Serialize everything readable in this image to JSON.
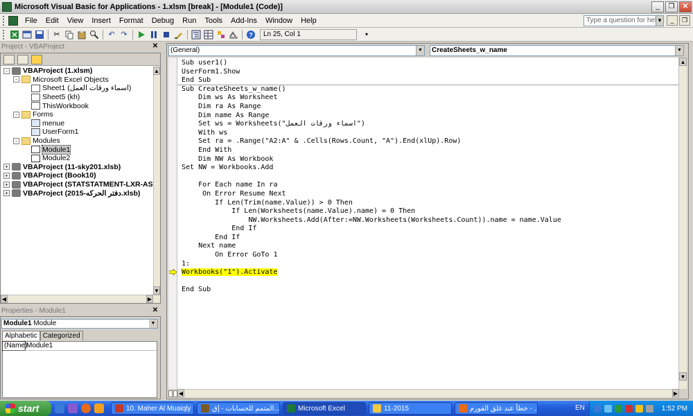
{
  "window": {
    "title": "Microsoft Visual Basic for Applications - 1.xlsm [break] - [Module1 (Code)]"
  },
  "menubar": {
    "items": [
      "File",
      "Edit",
      "View",
      "Insert",
      "Format",
      "Debug",
      "Run",
      "Tools",
      "Add-Ins",
      "Window",
      "Help"
    ],
    "help_placeholder": "Type a question for help"
  },
  "toolbar": {
    "position": "Ln 25, Col 1"
  },
  "project": {
    "title": "Project - VBAProject",
    "tree": [
      {
        "level": 0,
        "expander": "-",
        "icon": "vba",
        "label": "VBAProject (1.xlsm)",
        "bold": true
      },
      {
        "level": 1,
        "expander": "-",
        "icon": "folder",
        "label": "Microsoft Excel Objects"
      },
      {
        "level": 2,
        "expander": "",
        "icon": "sheet",
        "label": "Sheet1 (اسماء ورقات العمل)"
      },
      {
        "level": 2,
        "expander": "",
        "icon": "sheet",
        "label": "Sheet5 (kh)"
      },
      {
        "level": 2,
        "expander": "",
        "icon": "sheet",
        "label": "ThisWorkbook"
      },
      {
        "level": 1,
        "expander": "-",
        "icon": "folder",
        "label": "Forms"
      },
      {
        "level": 2,
        "expander": "",
        "icon": "form",
        "label": "menue"
      },
      {
        "level": 2,
        "expander": "",
        "icon": "form",
        "label": "UserForm1"
      },
      {
        "level": 1,
        "expander": "-",
        "icon": "folder",
        "label": "Modules"
      },
      {
        "level": 2,
        "expander": "",
        "icon": "module",
        "label": "Module1",
        "selected": true
      },
      {
        "level": 2,
        "expander": "",
        "icon": "module",
        "label": "Module2"
      },
      {
        "level": 0,
        "expander": "+",
        "icon": "vba",
        "label": "VBAProject (11-sky201.xlsb)",
        "bold": true
      },
      {
        "level": 0,
        "expander": "+",
        "icon": "vba",
        "label": "VBAProject (Book10)",
        "bold": true
      },
      {
        "level": 0,
        "expander": "+",
        "icon": "vba",
        "label": "VBAProject (STATSTATMENT-LXR-ASW-2015.",
        "bold": true
      },
      {
        "level": 0,
        "expander": "+",
        "icon": "vba",
        "label": "VBAProject (2015-دفتر الحركه.xlsb)",
        "bold": true
      }
    ]
  },
  "properties": {
    "title": "Properties - Module1",
    "object_name": "Module1",
    "object_type": "Module",
    "tabs": [
      "Alphabetic",
      "Categorized"
    ],
    "rows": [
      {
        "key": "(Name)",
        "value": "Module1"
      }
    ]
  },
  "code": {
    "object_combo": "(General)",
    "proc_combo": "CreateSheets_w_name",
    "lines": [
      "Sub user1()",
      "UserForm1.Show",
      "End Sub",
      "Sub CreateSheets_w_name()",
      "    Dim ws As Worksheet",
      "    Dim ra As Range",
      "    Dim name As Range",
      "    Set ws = Worksheets(\"اسماء ورقات العمل\")",
      "    With ws",
      "    Set ra = .Range(\"A2:A\" & .Cells(Rows.Count, \"A\").End(xlUp).Row)",
      "    End With",
      "    Dim NW As Workbook",
      "Set NW = Workbooks.Add",
      "",
      "    For Each name In ra",
      "     On Error Resume Next",
      "        If Len(Trim(name.Value)) > 0 Then",
      "            If Len(Worksheets(name.Value).name) = 0 Then",
      "                NW.Worksheets.Add(After:=NW.Worksheets(Worksheets.Count)).name = name.Value",
      "            End If",
      "        End If",
      "    Next name",
      "        On Error GoTo 1",
      "1:",
      "Workbooks(\"1\").Activate",
      "",
      "End Sub"
    ],
    "highlight_line": 24,
    "separator_after_line": 2
  },
  "taskbar": {
    "start_label": "start",
    "tasks": [
      {
        "label": "10. Maher Al Muaiqly ...",
        "color": "#c23a2b"
      },
      {
        "label": "المتمم للحسابات - [ق...",
        "color": "#7a5a2a"
      },
      {
        "label": "Microsoft Excel",
        "color": "#1d7a3a",
        "active": true
      },
      {
        "label": "11-2015",
        "color": "#f3c740"
      },
      {
        "label": "خطأ عند غلق الفورم - ...",
        "color": "#e86a1a"
      }
    ],
    "language": "EN",
    "clock": "1:52 PM"
  },
  "colors": {
    "highlight": "#ffff00",
    "keyword": "#000080",
    "taskbar": "#245edb",
    "start": "#2f8a2f"
  }
}
